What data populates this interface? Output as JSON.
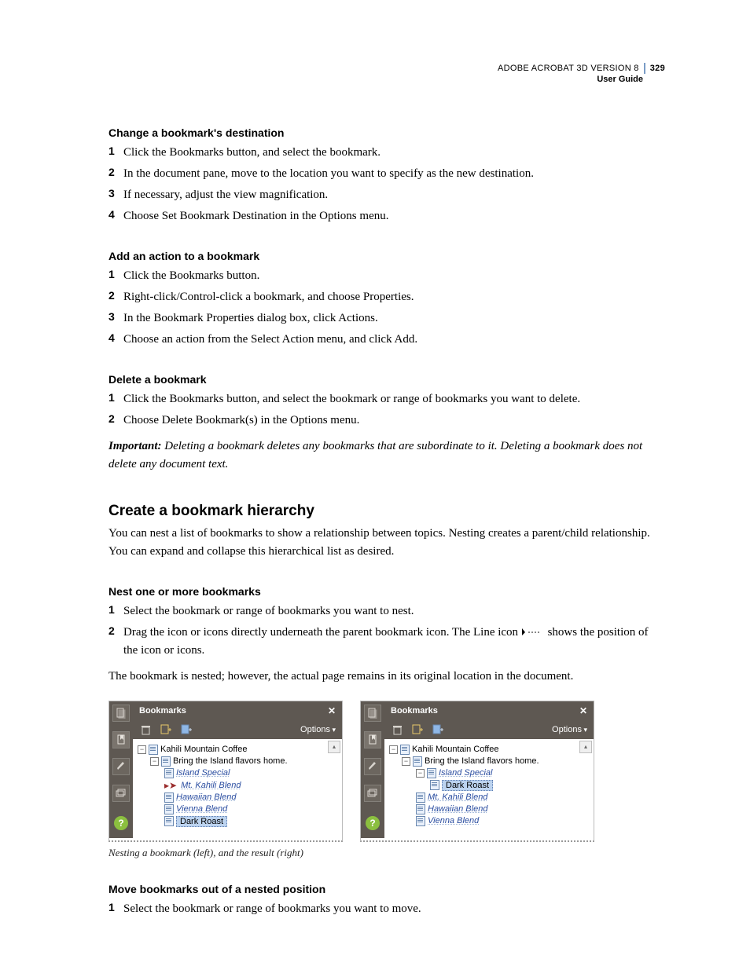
{
  "header": {
    "product": "ADOBE ACROBAT 3D VERSION 8",
    "guide": "User Guide",
    "page": "329"
  },
  "s1": {
    "title": "Change a bookmark's destination",
    "steps": [
      "Click the Bookmarks button, and select the bookmark.",
      "In the document pane, move to the location you want to specify as the new destination.",
      "If necessary, adjust the view magnification.",
      "Choose Set Bookmark Destination in the Options menu."
    ]
  },
  "s2": {
    "title": "Add an action to a bookmark",
    "steps": [
      "Click the Bookmarks button.",
      "Right-click/Control-click a bookmark, and choose Properties.",
      "In the Bookmark Properties dialog box, click Actions.",
      "Choose an action from the Select Action menu, and click Add."
    ]
  },
  "s3": {
    "title": "Delete a bookmark",
    "steps": [
      "Click the Bookmarks button, and select the bookmark or range of bookmarks you want to delete.",
      "Choose Delete Bookmark(s) in the Options menu."
    ],
    "note_label": "Important:",
    "note_text": "Deleting a bookmark deletes any bookmarks that are subordinate to it. Deleting a bookmark does not delete any document text."
  },
  "h2": "Create a bookmark hierarchy",
  "h2_para": "You can nest a list of bookmarks to show a relationship between topics. Nesting creates a parent/child relationship. You can expand and collapse this hierarchical list as desired.",
  "s4": {
    "title": "Nest one or more bookmarks",
    "step1": "Select the bookmark or range of bookmarks you want to nest.",
    "step2a": "Drag the icon or icons directly underneath the parent bookmark icon. The Line icon ",
    "step2b": " shows the position of the icon or icons.",
    "after": "The bookmark is nested; however, the actual page remains in its original location in the document."
  },
  "panels": {
    "title": "Bookmarks",
    "options": "Options",
    "left": {
      "root": "Kahili Mountain Coffee",
      "child": "Bring the Island flavors home.",
      "items": [
        "Island Special",
        "Mt. Kahili Blend",
        "Hawaiian Blend",
        "Vienna Blend",
        "Dark Roast"
      ]
    },
    "right": {
      "root": "Kahili Mountain Coffee",
      "child": "Bring the Island flavors home.",
      "sub": "Island Special",
      "sel": "Dark Roast",
      "rest": [
        "Mt. Kahili Blend",
        "Hawaiian Blend",
        "Vienna Blend"
      ]
    }
  },
  "caption": "Nesting a bookmark (left), and the result (right)",
  "s5": {
    "title": "Move bookmarks out of a nested position",
    "step1": "Select the bookmark or range of bookmarks you want to move."
  }
}
